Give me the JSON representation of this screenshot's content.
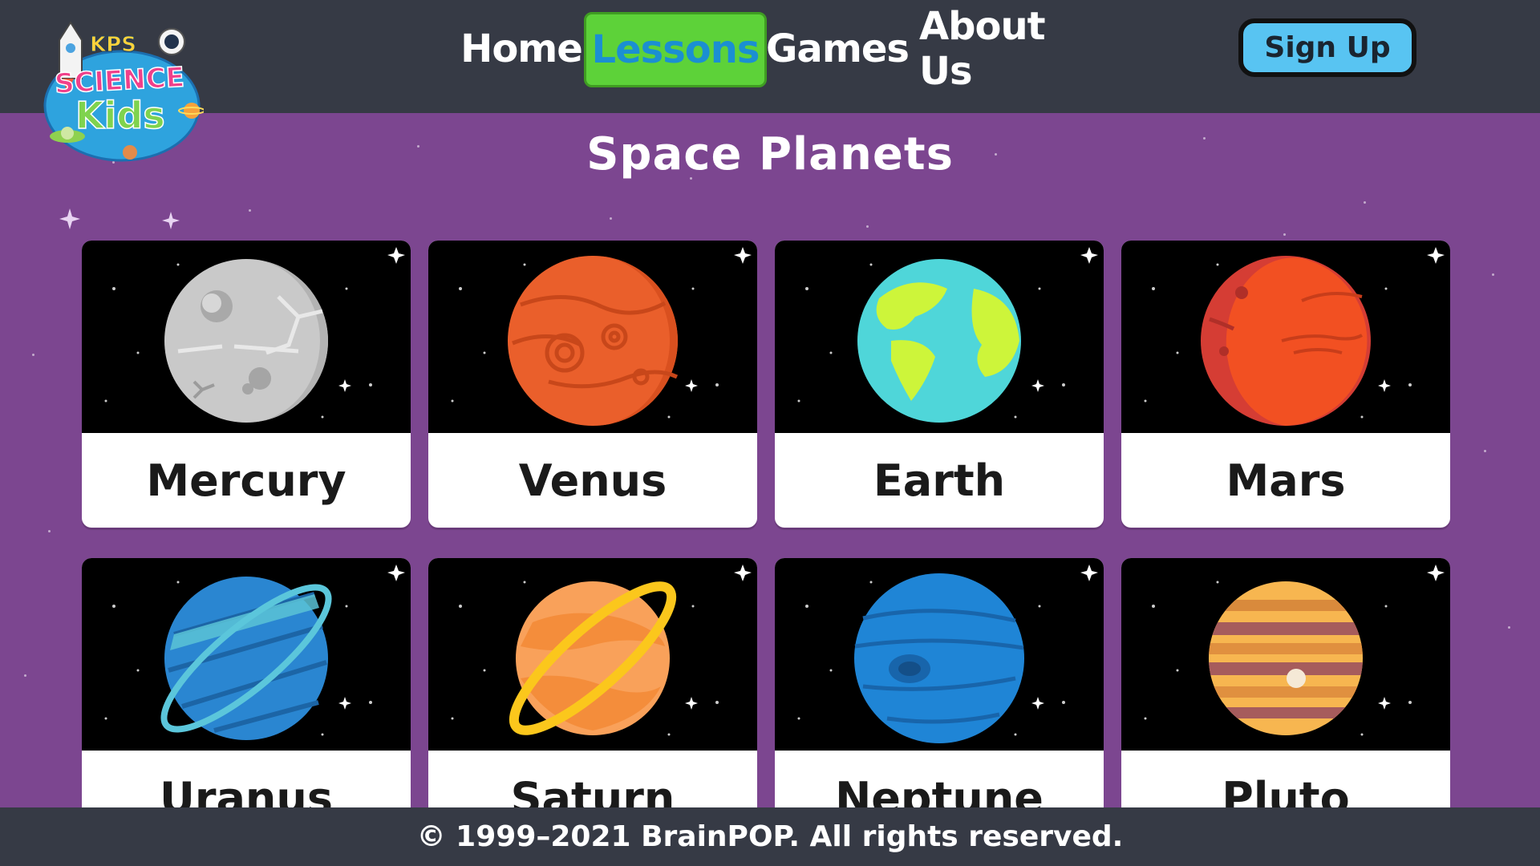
{
  "header": {
    "logo_text": [
      "KPS",
      "SCIENCE",
      "Kids"
    ],
    "nav": [
      {
        "label": "Home",
        "active": false
      },
      {
        "label": "Lessons",
        "active": true
      },
      {
        "label": "Games",
        "active": false
      },
      {
        "label": "About Us",
        "active": false
      }
    ],
    "signup_label": "Sign Up"
  },
  "page": {
    "title": "Space Planets"
  },
  "planets": [
    {
      "name": "Mercury",
      "icon": "mercury-icon"
    },
    {
      "name": "Venus",
      "icon": "venus-icon"
    },
    {
      "name": "Earth",
      "icon": "earth-icon"
    },
    {
      "name": "Mars",
      "icon": "mars-icon"
    },
    {
      "name": "Uranus",
      "icon": "uranus-icon"
    },
    {
      "name": "Saturn",
      "icon": "saturn-icon"
    },
    {
      "name": "Neptune",
      "icon": "neptune-icon"
    },
    {
      "name": "Pluto",
      "icon": "pluto-icon"
    }
  ],
  "footer": {
    "copyright": "© 1999–2021 BrainPOP. All rights reserved."
  },
  "colors": {
    "header_bg": "#363a45",
    "page_bg": "#7c4690",
    "active_nav_bg": "#5dd239",
    "active_nav_text": "#1b8fd2",
    "signup_bg": "#58c4f2"
  }
}
